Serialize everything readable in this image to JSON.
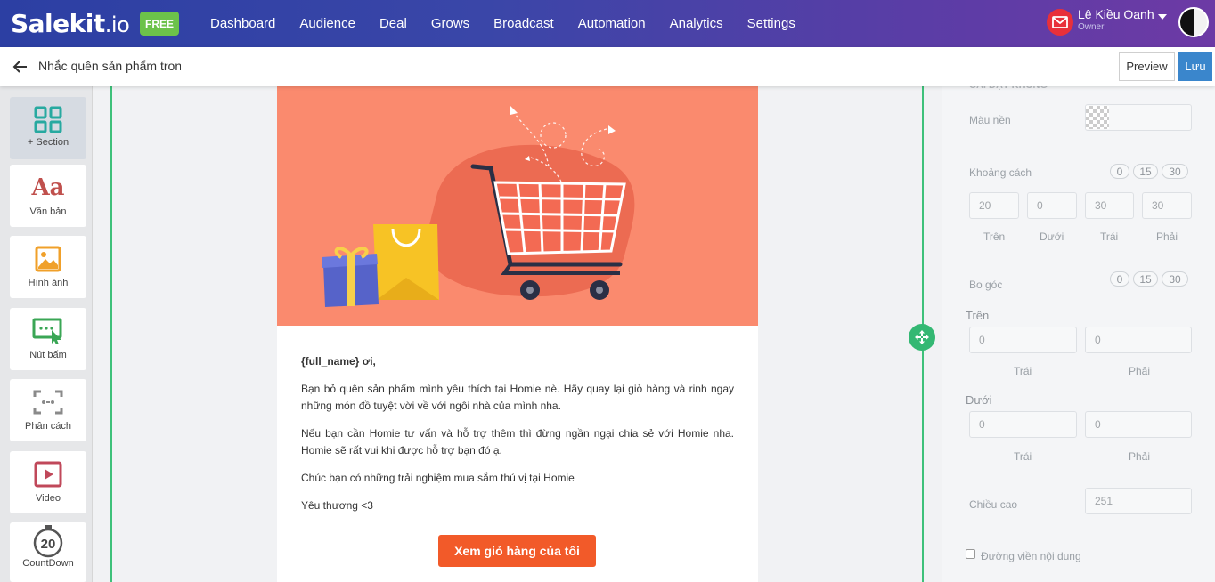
{
  "brand": {
    "logo_main": "Salekit",
    "logo_suffix": ".io",
    "plan_badge": "FREE"
  },
  "nav": {
    "items": [
      "Dashboard",
      "Audience",
      "Deal",
      "Grows",
      "Broadcast",
      "Automation",
      "Analytics",
      "Settings"
    ]
  },
  "user": {
    "name": "Lê Kiều Oanh",
    "role": "Owner"
  },
  "header": {
    "title": "Nhắc quên sản phẩm trong giỏ hàng",
    "preview_label": "Preview",
    "save_label": "Lưu"
  },
  "toolbar": {
    "items": [
      {
        "label": "+ Section",
        "icon": "grid-section-icon"
      },
      {
        "label": "Văn bản",
        "icon": "text-aa-icon"
      },
      {
        "label": "Hình ảnh",
        "icon": "image-icon"
      },
      {
        "label": "Nút bấm",
        "icon": "button-cursor-icon"
      },
      {
        "label": "Phân cách",
        "icon": "divider-icon"
      },
      {
        "label": "Video",
        "icon": "video-play-icon"
      },
      {
        "label": "CountDown",
        "icon": "countdown-timer-icon"
      }
    ],
    "countdown_number": "20"
  },
  "email": {
    "greeting": "{full_name} ơi,",
    "paragraphs": [
      "Bạn bỏ quên sản phẩm mình yêu thích tại Homie nè. Hãy quay lại giỏ hàng và rinh ngay những món đồ tuyệt vời về với ngôi nhà của mình nha.",
      "Nếu bạn cần Homie tư vấn và hỗ trợ thêm thì đừng ngần ngại chia sẻ với Homie nha. Homie sẽ rất vui khi được hỗ trợ bạn đó ạ.",
      "Chúc bạn có những trải nghiệm mua sắm thú vị tại Homie",
      "Yêu thương <3"
    ],
    "cta_label": "Xem giỏ hàng của tôi",
    "hero_bg_color": "#fa8a6e",
    "cta_color": "#f25a29"
  },
  "settings": {
    "section_heading": "CÀI ĐẶT KHUNG",
    "background_label": "Màu nền",
    "spacing_label": "Khoảng cách",
    "spacing_presets": [
      "0",
      "15",
      "30"
    ],
    "spacing_values": [
      "20",
      "0",
      "30",
      "30"
    ],
    "spacing_sides": [
      "Trên",
      "Dưới",
      "Trái",
      "Phải"
    ],
    "radius_label": "Bo góc",
    "radius_presets": [
      "0",
      "15",
      "30"
    ],
    "radius_top_label": "Trên",
    "radius_top_values": [
      "0",
      "0"
    ],
    "radius_top_sides": [
      "Trái",
      "Phải"
    ],
    "radius_bottom_label": "Dưới",
    "radius_bottom_values": [
      "0",
      "0"
    ],
    "radius_bottom_sides": [
      "Trái",
      "Phải"
    ],
    "height_label": "Chiều cao",
    "height_placeholder": "251",
    "border_label": "Đường viền nội dung"
  },
  "colors": {
    "nav_start": "#2c3fa3",
    "nav_end": "#6d3aa5",
    "accent_green": "#34b873",
    "save_blue": "#3a86cc",
    "free_green": "#6cc24a"
  }
}
